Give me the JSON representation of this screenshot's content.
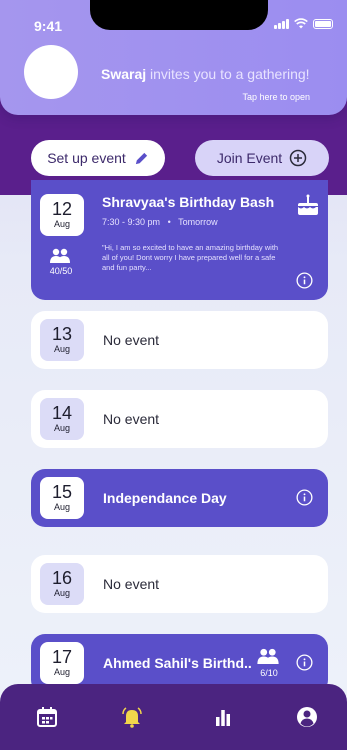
{
  "status_bar": {
    "time": "9:41"
  },
  "notification": {
    "sender": "Swaraj",
    "message": "invites you to a gathering!",
    "action": "Tap here to open"
  },
  "actions": {
    "setup_label": "Set up event",
    "join_label": "Join Event"
  },
  "featured_event": {
    "day": "12",
    "month": "Aug",
    "title": "Shravyaa's Birthday Bash",
    "time": "7:30 - 9:30 pm",
    "when": "Tomorrow",
    "description": "\"Hi, I am so  excited to have an amazing birthday with all of you! Dont worry I have prepared well for a safe and fun party...",
    "attendees": "40/50"
  },
  "days": [
    {
      "day": "13",
      "month": "Aug",
      "title": "No event",
      "type": "plain"
    },
    {
      "day": "14",
      "month": "Aug",
      "title": "No event",
      "type": "plain"
    },
    {
      "day": "15",
      "month": "Aug",
      "title": "Independance Day",
      "type": "event"
    },
    {
      "day": "16",
      "month": "Aug",
      "title": "No event",
      "type": "plain"
    },
    {
      "day": "17",
      "month": "Aug",
      "title": "Ahmed Sahil's Birthd..",
      "type": "event",
      "attendees": "6/10"
    }
  ],
  "bottom_nav": {
    "icons": [
      "calendar-icon",
      "bell-icon",
      "bar-chart-icon",
      "user-icon"
    ]
  },
  "colors": {
    "header": "#5a1f8c",
    "event_card": "#5a4fc9",
    "notification": "#a596ee",
    "nav": "#4b2480"
  }
}
